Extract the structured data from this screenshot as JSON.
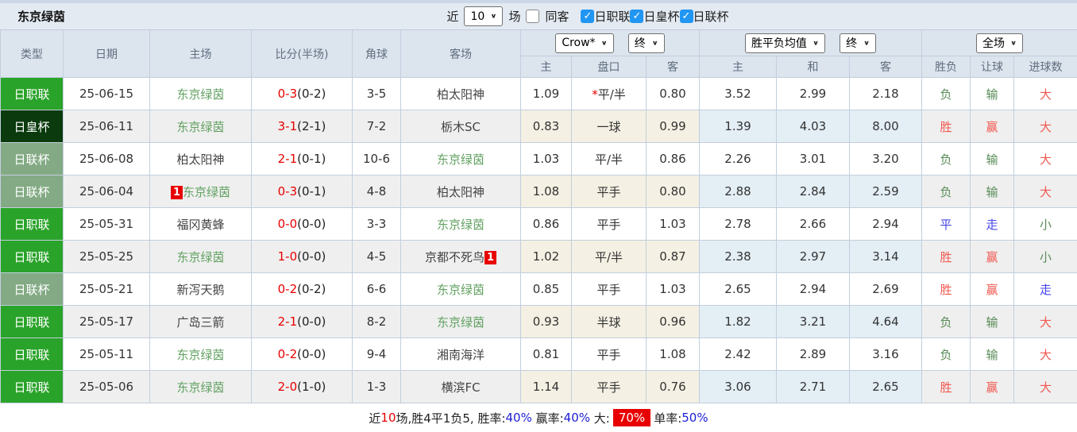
{
  "page_title": "东京绿茵",
  "topbar": {
    "recent_label": "近",
    "recent_value": "10",
    "matches_label": "场",
    "same_away_label": "同客",
    "same_away_checked": false,
    "check_glyph": "✓",
    "leagues": [
      {
        "label": "日职联",
        "checked": true
      },
      {
        "label": "日皇杯",
        "checked": true
      },
      {
        "label": "日联杯",
        "checked": true
      }
    ]
  },
  "table": {
    "selects": {
      "company": "Crow*",
      "company_time": "终",
      "avg_type": "胜平负均值",
      "avg_time": "终",
      "scope": "全场"
    },
    "headers": {
      "type": "类型",
      "date": "日期",
      "home": "主场",
      "score": "比分(半场)",
      "corners": "角球",
      "away": "客场",
      "odds_home": "主",
      "odds_line": "盘口",
      "odds_away": "客",
      "avg_home": "主",
      "avg_draw": "和",
      "avg_away": "客",
      "result": "胜负",
      "handicap": "让球",
      "goals": "进球数"
    },
    "colors": {
      "league_bright": "#2aa32a",
      "league_dark": "#0a3a0d",
      "league_sage": "#83aa84",
      "team_green": "#61a161",
      "score_red": "#e80000",
      "win_red": "#f25850",
      "lose_green": "#578b57",
      "draw_blue": "#4444e8",
      "checkbox_blue": "#2196f3"
    },
    "rows": [
      {
        "type": "日职联",
        "type_style": "bright",
        "date": "25-06-15",
        "home": "东京绿茵",
        "home_green": true,
        "score": "0-3",
        "half": "(0-2)",
        "corners": "3-5",
        "away": "柏太阳神",
        "away_green": false,
        "odds_home": "1.09",
        "line_prefix": "*",
        "line": "平/半",
        "odds_away": "0.80",
        "avg": [
          "3.52",
          "2.99",
          "2.18"
        ],
        "result": {
          "text": "负",
          "color": "green"
        },
        "handicap": {
          "text": "输",
          "color": "green"
        },
        "goals": {
          "text": "大",
          "color": "red"
        }
      },
      {
        "type": "日皇杯",
        "type_style": "dark",
        "date": "25-06-11",
        "home": "东京绿茵",
        "home_green": true,
        "score": "3-1",
        "half": "(2-1)",
        "corners": "7-2",
        "away": "栃木SC",
        "away_green": false,
        "odds_home": "0.83",
        "line": "一球",
        "odds_away": "0.99",
        "avg": [
          "1.39",
          "4.03",
          "8.00"
        ],
        "result": {
          "text": "胜",
          "color": "red"
        },
        "handicap": {
          "text": "赢",
          "color": "red"
        },
        "goals": {
          "text": "大",
          "color": "red"
        }
      },
      {
        "type": "日联杯",
        "type_style": "sage",
        "date": "25-06-08",
        "home": "柏太阳神",
        "home_green": false,
        "score": "2-1",
        "half": "(0-1)",
        "corners": "10-6",
        "away": "东京绿茵",
        "away_green": true,
        "odds_home": "1.03",
        "line": "平/半",
        "odds_away": "0.86",
        "avg": [
          "2.26",
          "3.01",
          "3.20"
        ],
        "result": {
          "text": "负",
          "color": "green"
        },
        "handicap": {
          "text": "输",
          "color": "green"
        },
        "goals": {
          "text": "大",
          "color": "red"
        }
      },
      {
        "type": "日联杯",
        "type_style": "sage",
        "date": "25-06-04",
        "home": "东京绿茵",
        "home_green": true,
        "home_badge": "1",
        "score": "0-3",
        "half": "(0-1)",
        "corners": "4-8",
        "away": "柏太阳神",
        "away_green": false,
        "odds_home": "1.08",
        "line": "平手",
        "odds_away": "0.80",
        "avg": [
          "2.88",
          "2.84",
          "2.59"
        ],
        "result": {
          "text": "负",
          "color": "green"
        },
        "handicap": {
          "text": "输",
          "color": "green"
        },
        "goals": {
          "text": "大",
          "color": "red"
        }
      },
      {
        "type": "日职联",
        "type_style": "bright",
        "date": "25-05-31",
        "home": "福冈黄蜂",
        "home_green": false,
        "score": "0-0",
        "half": "(0-0)",
        "corners": "3-3",
        "away": "东京绿茵",
        "away_green": true,
        "odds_home": "0.86",
        "line": "平手",
        "odds_away": "1.03",
        "avg": [
          "2.78",
          "2.66",
          "2.94"
        ],
        "result": {
          "text": "平",
          "color": "blue"
        },
        "handicap": {
          "text": "走",
          "color": "blue"
        },
        "goals": {
          "text": "小",
          "color": "green"
        }
      },
      {
        "type": "日职联",
        "type_style": "bright",
        "date": "25-05-25",
        "home": "东京绿茵",
        "home_green": true,
        "score": "1-0",
        "half": "(0-0)",
        "corners": "4-5",
        "away": "京都不死鸟",
        "away_green": false,
        "away_badge": "1",
        "odds_home": "1.02",
        "line": "平/半",
        "odds_away": "0.87",
        "avg": [
          "2.38",
          "2.97",
          "3.14"
        ],
        "result": {
          "text": "胜",
          "color": "red"
        },
        "handicap": {
          "text": "赢",
          "color": "red"
        },
        "goals": {
          "text": "小",
          "color": "green"
        }
      },
      {
        "type": "日联杯",
        "type_style": "sage",
        "date": "25-05-21",
        "home": "新泻天鹅",
        "home_green": false,
        "score": "0-2",
        "half": "(0-2)",
        "corners": "6-6",
        "away": "东京绿茵",
        "away_green": true,
        "odds_home": "0.85",
        "line": "平手",
        "odds_away": "1.03",
        "avg": [
          "2.65",
          "2.94",
          "2.69"
        ],
        "result": {
          "text": "胜",
          "color": "red"
        },
        "handicap": {
          "text": "赢",
          "color": "red"
        },
        "goals": {
          "text": "走",
          "color": "blue"
        }
      },
      {
        "type": "日职联",
        "type_style": "bright",
        "date": "25-05-17",
        "home": "广岛三箭",
        "home_green": false,
        "score": "2-1",
        "half": "(0-0)",
        "corners": "8-2",
        "away": "东京绿茵",
        "away_green": true,
        "odds_home": "0.93",
        "line": "半球",
        "odds_away": "0.96",
        "avg": [
          "1.82",
          "3.21",
          "4.64"
        ],
        "result": {
          "text": "负",
          "color": "green"
        },
        "handicap": {
          "text": "输",
          "color": "green"
        },
        "goals": {
          "text": "大",
          "color": "red"
        }
      },
      {
        "type": "日职联",
        "type_style": "bright",
        "date": "25-05-11",
        "home": "东京绿茵",
        "home_green": true,
        "score": "0-2",
        "half": "(0-0)",
        "corners": "9-4",
        "away": "湘南海洋",
        "away_green": false,
        "odds_home": "0.81",
        "line": "平手",
        "odds_away": "1.08",
        "avg": [
          "2.42",
          "2.89",
          "3.16"
        ],
        "result": {
          "text": "负",
          "color": "green"
        },
        "handicap": {
          "text": "输",
          "color": "green"
        },
        "goals": {
          "text": "大",
          "color": "red"
        }
      },
      {
        "type": "日职联",
        "type_style": "bright",
        "date": "25-05-06",
        "home": "东京绿茵",
        "home_green": true,
        "score": "2-0",
        "half": "(1-0)",
        "corners": "1-3",
        "away": "横滨FC",
        "away_green": false,
        "odds_home": "1.14",
        "line": "平手",
        "odds_away": "0.76",
        "avg": [
          "3.06",
          "2.71",
          "2.65"
        ],
        "result": {
          "text": "胜",
          "color": "red"
        },
        "handicap": {
          "text": "赢",
          "color": "red"
        },
        "goals": {
          "text": "大",
          "color": "red"
        }
      }
    ]
  },
  "footer": {
    "segments": [
      {
        "text": "近",
        "style": "plain"
      },
      {
        "text": "10",
        "style": "red"
      },
      {
        "text": "场,胜4平1负5, ",
        "style": "plain"
      },
      {
        "text": "胜率:",
        "style": "plain"
      },
      {
        "text": "40%",
        "style": "blue"
      },
      {
        "text": " 赢率:",
        "style": "plain"
      },
      {
        "text": "40%",
        "style": "blue"
      },
      {
        "text": " 大:",
        "style": "plain"
      },
      {
        "text": "70%",
        "style": "redbg"
      },
      {
        "text": "单率:",
        "style": "plain"
      },
      {
        "text": "50%",
        "style": "blue"
      }
    ]
  }
}
